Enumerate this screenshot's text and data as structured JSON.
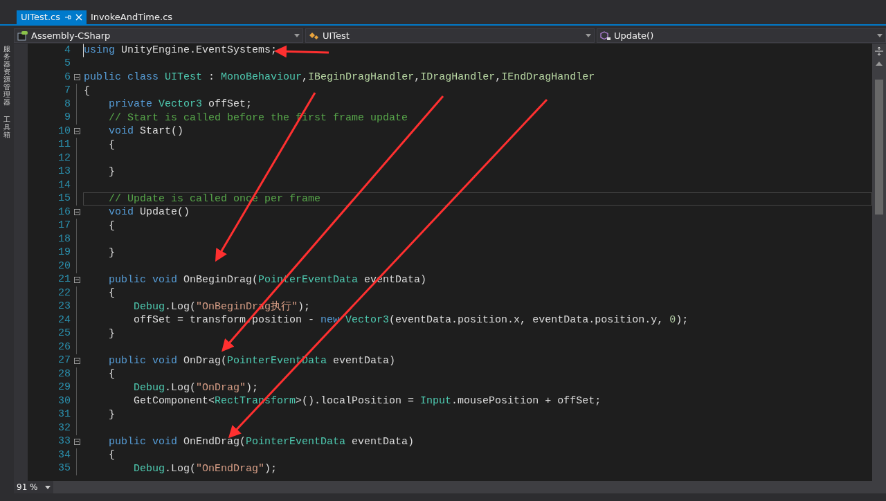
{
  "tabs": [
    {
      "label": "UITest.cs",
      "selected": true,
      "pinnable": true,
      "closable": true
    },
    {
      "label": "InvokeAndTime.cs",
      "selected": false,
      "pinnable": false,
      "closable": false
    }
  ],
  "navigation": [
    {
      "kind": "project",
      "label": "Assembly-CSharp"
    },
    {
      "kind": "class",
      "label": "UITest"
    },
    {
      "kind": "method",
      "label": "Update()"
    }
  ],
  "side_panels": [
    "服务器资源管理器",
    "工具箱"
  ],
  "lines": [
    {
      "number": "4",
      "fold": false,
      "current": false,
      "caret": true,
      "tokens": [
        {
          "kind": "keyword",
          "text": "using"
        },
        {
          "kind": "plain",
          "text": " UnityEngine.EventSystems;"
        }
      ]
    },
    {
      "number": "5",
      "fold": false,
      "current": false,
      "caret": false
    },
    {
      "number": "6",
      "fold": true,
      "current": false,
      "caret": false,
      "tokens": [
        {
          "kind": "keyword",
          "text": "public class "
        },
        {
          "kind": "type",
          "text": "UITest"
        },
        {
          "kind": "plain",
          "text": " : "
        },
        {
          "kind": "type",
          "text": "MonoBehaviour"
        },
        {
          "kind": "plain",
          "text": ","
        },
        {
          "kind": "interface",
          "text": "IBeginDragHandler"
        },
        {
          "kind": "plain",
          "text": ","
        },
        {
          "kind": "interface",
          "text": "IDragHandler"
        },
        {
          "kind": "plain",
          "text": ","
        },
        {
          "kind": "interface",
          "text": "IEndDragHandler"
        }
      ]
    },
    {
      "number": "7",
      "fold": false,
      "current": false,
      "caret": false,
      "tokens": [
        {
          "kind": "plain",
          "text": "{"
        }
      ]
    },
    {
      "number": "8",
      "fold": false,
      "current": false,
      "caret": false,
      "tokens": [
        {
          "kind": "keyword",
          "text": "    private "
        },
        {
          "kind": "type",
          "text": "Vector3"
        },
        {
          "kind": "plain",
          "text": " offSet;"
        }
      ]
    },
    {
      "number": "9",
      "fold": false,
      "current": false,
      "caret": false,
      "tokens": [
        {
          "kind": "comment",
          "text": "    // Start is called before the first frame update"
        }
      ]
    },
    {
      "number": "10",
      "fold": true,
      "current": false,
      "caret": false,
      "tokens": [
        {
          "kind": "keyword",
          "text": "    void"
        },
        {
          "kind": "plain",
          "text": " Start()"
        }
      ]
    },
    {
      "number": "11",
      "fold": false,
      "current": false,
      "caret": false,
      "tokens": [
        {
          "kind": "plain",
          "text": "    {"
        }
      ]
    },
    {
      "number": "12",
      "fold": false,
      "current": false,
      "caret": false
    },
    {
      "number": "13",
      "fold": false,
      "current": false,
      "caret": false,
      "tokens": [
        {
          "kind": "plain",
          "text": "    }"
        }
      ]
    },
    {
      "number": "14",
      "fold": false,
      "current": false,
      "caret": false
    },
    {
      "number": "15",
      "fold": false,
      "current": true,
      "caret": false,
      "tokens": [
        {
          "kind": "comment",
          "text": "    // Update is called once per frame"
        }
      ]
    },
    {
      "number": "16",
      "fold": true,
      "current": false,
      "caret": false,
      "tokens": [
        {
          "kind": "keyword",
          "text": "    void"
        },
        {
          "kind": "plain",
          "text": " Update()"
        }
      ]
    },
    {
      "number": "17",
      "fold": false,
      "current": false,
      "caret": false,
      "tokens": [
        {
          "kind": "plain",
          "text": "    {"
        }
      ]
    },
    {
      "number": "18",
      "fold": false,
      "current": false,
      "caret": false
    },
    {
      "number": "19",
      "fold": false,
      "current": false,
      "caret": false,
      "tokens": [
        {
          "kind": "plain",
          "text": "    }"
        }
      ]
    },
    {
      "number": "20",
      "fold": false,
      "current": false,
      "caret": false
    },
    {
      "number": "21",
      "fold": true,
      "current": false,
      "caret": false,
      "tokens": [
        {
          "kind": "keyword",
          "text": "    public void"
        },
        {
          "kind": "plain",
          "text": " OnBeginDrag("
        },
        {
          "kind": "type",
          "text": "PointerEventData"
        },
        {
          "kind": "plain",
          "text": " eventData)"
        }
      ]
    },
    {
      "number": "22",
      "fold": false,
      "current": false,
      "caret": false,
      "tokens": [
        {
          "kind": "plain",
          "text": "    {"
        }
      ]
    },
    {
      "number": "23",
      "fold": false,
      "current": false,
      "caret": false,
      "tokens": [
        {
          "kind": "type",
          "text": "        Debug"
        },
        {
          "kind": "plain",
          "text": ".Log("
        },
        {
          "kind": "string",
          "text": "\"OnBeginDrag执行\""
        },
        {
          "kind": "plain",
          "text": ");"
        }
      ]
    },
    {
      "number": "24",
      "fold": false,
      "current": false,
      "caret": false,
      "tokens": [
        {
          "kind": "plain",
          "text": "        offSet = transform.position - "
        },
        {
          "kind": "keyword",
          "text": "new"
        },
        {
          "kind": "type",
          "text": " Vector3"
        },
        {
          "kind": "plain",
          "text": "(eventData.position.x, eventData.position.y, "
        },
        {
          "kind": "number",
          "text": "0"
        },
        {
          "kind": "plain",
          "text": ");"
        }
      ]
    },
    {
      "number": "25",
      "fold": false,
      "current": false,
      "caret": false,
      "tokens": [
        {
          "kind": "plain",
          "text": "    }"
        }
      ]
    },
    {
      "number": "26",
      "fold": false,
      "current": false,
      "caret": false
    },
    {
      "number": "27",
      "fold": true,
      "current": false,
      "caret": false,
      "tokens": [
        {
          "kind": "keyword",
          "text": "    public void"
        },
        {
          "kind": "plain",
          "text": " OnDrag("
        },
        {
          "kind": "type",
          "text": "PointerEventData"
        },
        {
          "kind": "plain",
          "text": " eventData)"
        }
      ]
    },
    {
      "number": "28",
      "fold": false,
      "current": false,
      "caret": false,
      "tokens": [
        {
          "kind": "plain",
          "text": "    {"
        }
      ]
    },
    {
      "number": "29",
      "fold": false,
      "current": false,
      "caret": false,
      "tokens": [
        {
          "kind": "type",
          "text": "        Debug"
        },
        {
          "kind": "plain",
          "text": ".Log("
        },
        {
          "kind": "string",
          "text": "\"OnDrag\""
        },
        {
          "kind": "plain",
          "text": ");"
        }
      ]
    },
    {
      "number": "30",
      "fold": false,
      "current": false,
      "caret": false,
      "tokens": [
        {
          "kind": "plain",
          "text": "        GetComponent<"
        },
        {
          "kind": "type",
          "text": "RectTransform"
        },
        {
          "kind": "plain",
          "text": ">().localPosition = "
        },
        {
          "kind": "type",
          "text": "Input"
        },
        {
          "kind": "plain",
          "text": ".mousePosition + offSet;"
        }
      ]
    },
    {
      "number": "31",
      "fold": false,
      "current": false,
      "caret": false,
      "tokens": [
        {
          "kind": "plain",
          "text": "    }"
        }
      ]
    },
    {
      "number": "32",
      "fold": false,
      "current": false,
      "caret": false
    },
    {
      "number": "33",
      "fold": true,
      "current": false,
      "caret": false,
      "tokens": [
        {
          "kind": "keyword",
          "text": "    public void"
        },
        {
          "kind": "plain",
          "text": " OnEndDrag("
        },
        {
          "kind": "type",
          "text": "PointerEventData"
        },
        {
          "kind": "plain",
          "text": " eventData)"
        }
      ]
    },
    {
      "number": "34",
      "fold": false,
      "current": false,
      "caret": false,
      "tokens": [
        {
          "kind": "plain",
          "text": "    {"
        }
      ]
    },
    {
      "number": "35",
      "fold": false,
      "current": false,
      "caret": false,
      "tokens": [
        {
          "kind": "type",
          "text": "        Debug"
        },
        {
          "kind": "plain",
          "text": ".Log("
        },
        {
          "kind": "string",
          "text": "\"OnEndDrag\""
        },
        {
          "kind": "plain",
          "text": ");"
        }
      ]
    }
  ],
  "zoom": "91 %"
}
